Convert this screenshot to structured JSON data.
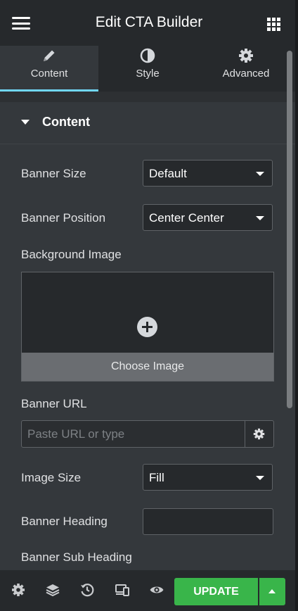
{
  "header": {
    "title": "Edit CTA Builder",
    "menu_icon": "hamburger-icon",
    "apps_icon": "grid-icon"
  },
  "tabs": [
    {
      "label": "Content",
      "icon": "pencil-icon",
      "active": true
    },
    {
      "label": "Style",
      "icon": "contrast-icon",
      "active": false
    },
    {
      "label": "Advanced",
      "icon": "gear-icon",
      "active": false
    }
  ],
  "section": {
    "title": "Content",
    "expanded": true
  },
  "fields": {
    "banner_size": {
      "label": "Banner Size",
      "value": "Default"
    },
    "banner_position": {
      "label": "Banner Position",
      "value": "Center Center"
    },
    "background_image": {
      "label": "Background Image",
      "choose_label": "Choose Image"
    },
    "banner_url": {
      "label": "Banner URL",
      "value": "",
      "placeholder": "Paste URL or type"
    },
    "image_size": {
      "label": "Image Size",
      "value": "Fill"
    },
    "banner_heading": {
      "label": "Banner Heading",
      "value": ""
    },
    "banner_sub_heading": {
      "label": "Banner Sub Heading"
    }
  },
  "footer": {
    "icons": [
      "settings-icon",
      "layers-icon",
      "history-icon",
      "responsive-icon",
      "preview-icon"
    ],
    "update_label": "UPDATE"
  },
  "colors": {
    "panel_bg": "#34383c",
    "header_bg": "#26292c",
    "accent_tab": "#71d7f7",
    "update_green": "#39b54a"
  }
}
